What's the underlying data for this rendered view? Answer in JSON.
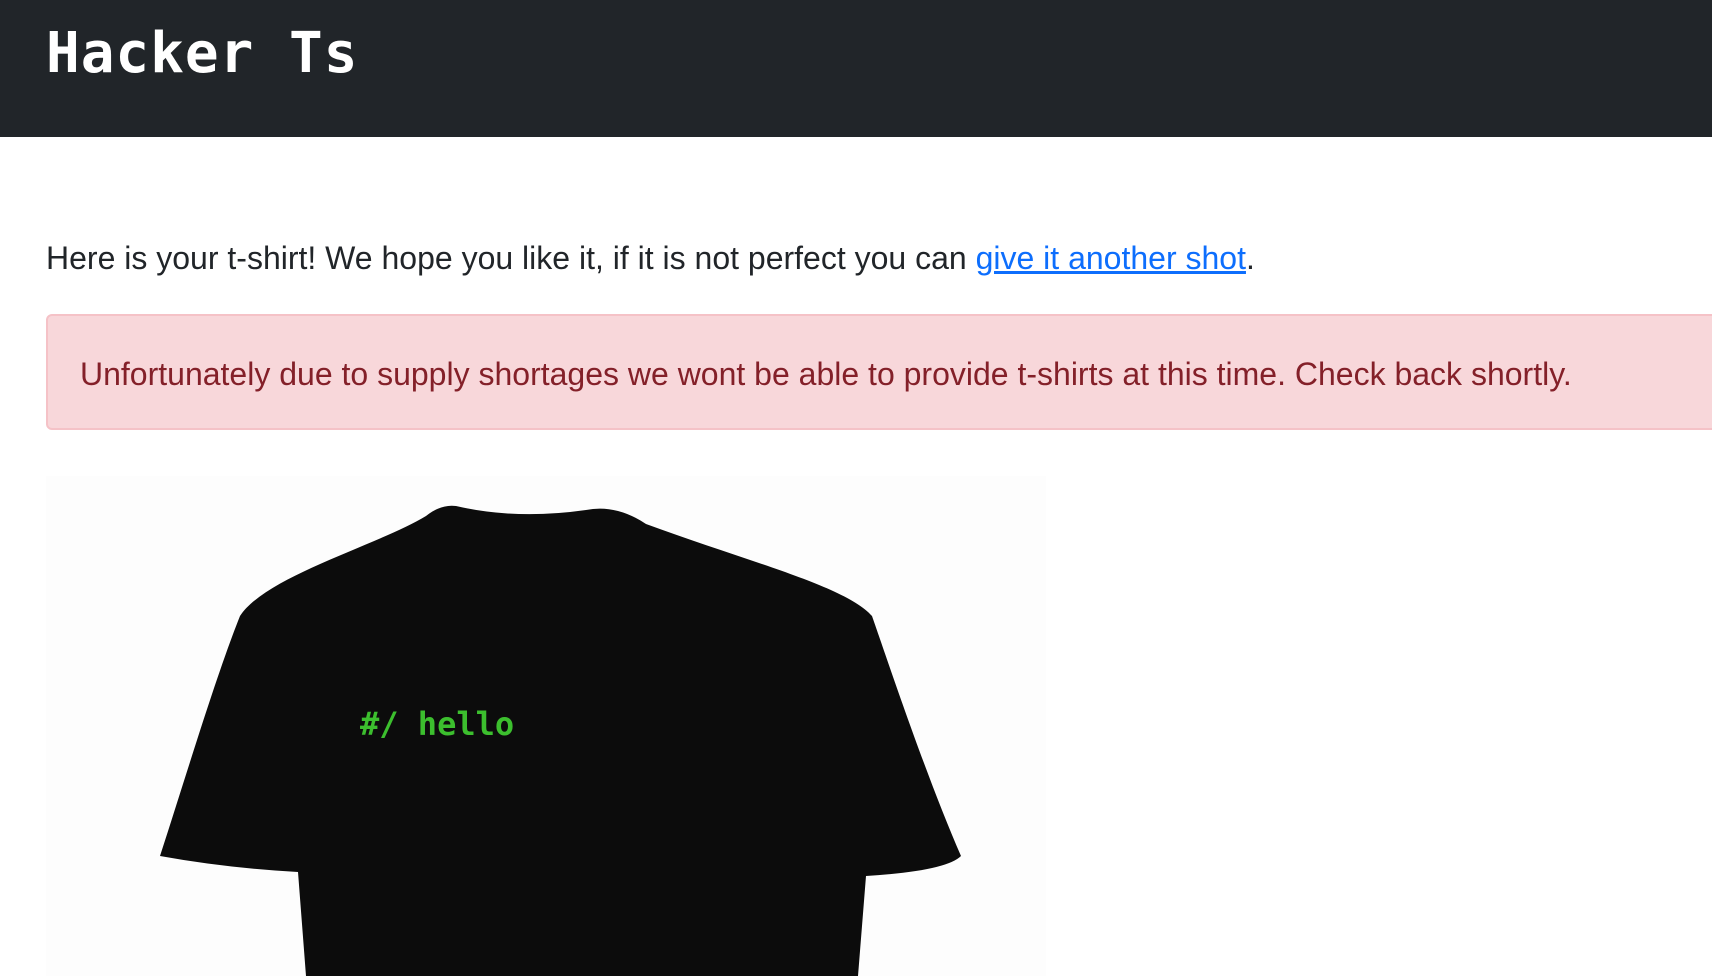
{
  "navbar": {
    "brand": "Hacker Ts"
  },
  "intro": {
    "text_before": "Here is your t-shirt! We hope you like it, if it is not perfect you can ",
    "link_text": "give it another shot",
    "text_after": "."
  },
  "alert": {
    "message": "Unfortunately due to supply shortages we wont be able to provide t-shirts at this time. Check back shortly."
  },
  "tshirt": {
    "print_text": "#/ hello",
    "shirt_color": "#0c0c0c",
    "text_color": "#3cbf2e"
  },
  "colors": {
    "navbar_bg": "#212529",
    "link": "#0d6efd",
    "alert_bg": "#f8d7da",
    "alert_border": "#f5c2c7",
    "alert_text": "#842029"
  }
}
